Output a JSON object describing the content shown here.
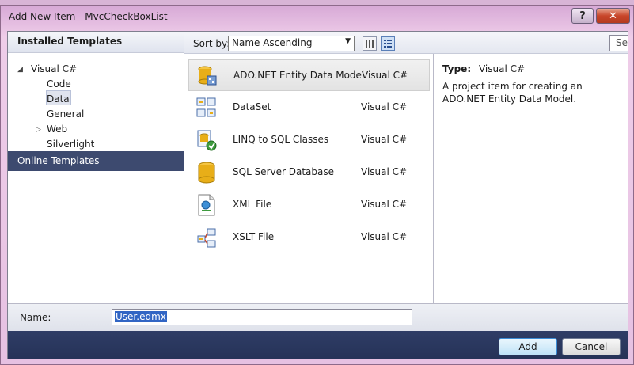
{
  "window": {
    "title": "Add New Item - MvcCheckBoxList",
    "help_label": "?",
    "close_label": "✕"
  },
  "left": {
    "installed_header": "Installed Templates",
    "tree": [
      {
        "label": "Visual C#",
        "arrow": "◢",
        "indent": 0
      },
      {
        "label": "Code",
        "indent": 1
      },
      {
        "label": "Data",
        "indent": 1,
        "selected": true
      },
      {
        "label": "General",
        "indent": 1
      },
      {
        "label": "Web",
        "arrow": "▷",
        "indent": 1
      },
      {
        "label": "Silverlight",
        "indent": 1
      }
    ],
    "online_header": "Online Templates"
  },
  "toolbar": {
    "sort_label": "Sort by:",
    "sort_value": "Name Ascending",
    "search_placeholder": "Search Installed Templates"
  },
  "items": [
    {
      "name": "ADO.NET Entity Data Model",
      "lang": "Visual C#",
      "icon": "entity-model-icon",
      "selected": true
    },
    {
      "name": "DataSet",
      "lang": "Visual C#",
      "icon": "dataset-icon"
    },
    {
      "name": "LINQ to SQL Classes",
      "lang": "Visual C#",
      "icon": "linq-to-sql-icon"
    },
    {
      "name": "SQL Server Database",
      "lang": "Visual C#",
      "icon": "database-icon"
    },
    {
      "name": "XML File",
      "lang": "Visual C#",
      "icon": "xml-file-icon"
    },
    {
      "name": "XSLT File",
      "lang": "Visual C#",
      "icon": "xslt-file-icon"
    }
  ],
  "details": {
    "type_label": "Type:",
    "type_value": "Visual C#",
    "description": "A project item for creating an ADO.NET Entity Data Model."
  },
  "footer": {
    "name_label": "Name:",
    "name_value": "User.edmx",
    "add_label": "Add",
    "cancel_label": "Cancel"
  }
}
